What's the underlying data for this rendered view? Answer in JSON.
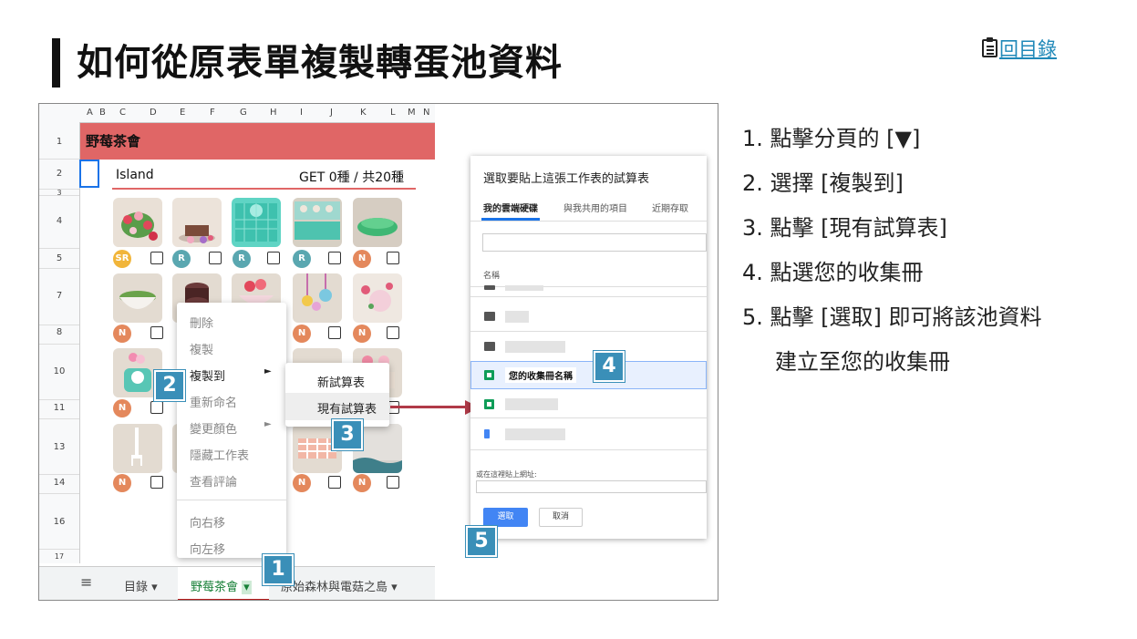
{
  "heading": "如何從原表單複製轉蛋池資料",
  "toc_link": "回目錄",
  "sheet": {
    "columns": [
      "A",
      "B",
      "C",
      "D",
      "E",
      "F",
      "G",
      "H",
      "I",
      "J",
      "K",
      "L",
      "M",
      "N"
    ],
    "rows": [
      "1",
      "2",
      "3",
      "4",
      "5",
      "7",
      "8",
      "10",
      "11",
      "13",
      "14",
      "16",
      "17"
    ],
    "banner": "野莓茶會",
    "subtitle": "Island",
    "get_count": "GET 0種 / 共20種",
    "badges": [
      "SR",
      "R",
      "R",
      "R",
      "N",
      "N",
      "N",
      "N",
      "N",
      "N",
      "N",
      "N",
      "N"
    ]
  },
  "context_menu": {
    "items": [
      "刪除",
      "複製",
      "複製到",
      "重新命名",
      "變更顏色",
      "隱藏工作表",
      "查看評論",
      "向右移",
      "向左移"
    ],
    "submenu_arrow": "►"
  },
  "submenu": {
    "items": [
      "新試算表",
      "現有試算表"
    ]
  },
  "tabs": {
    "menu_icon": "≡",
    "items": [
      "目錄",
      "野莓茶會",
      "原始森林與電菇之島"
    ],
    "caret": "▾"
  },
  "dialog": {
    "title": "選取要貼上這張工作表的試算表",
    "tabs": [
      "我的雲端硬碟",
      "與我共用的項目",
      "近期存取"
    ],
    "column_header": "名稱",
    "highlighted_file": "您的收集冊名稱",
    "url_label": "或在這裡貼上網址:",
    "select_button": "選取",
    "cancel_button": "取消"
  },
  "callouts": [
    "1",
    "2",
    "3",
    "4",
    "5"
  ],
  "steps": [
    "1. 點擊分頁的 [▼]",
    "2. 選擇 [複製到]",
    "3. 點擊 [現有試算表]",
    "4. 點選您的收集冊",
    "5. 點擊 [選取] 即可將該池資料",
    "建立至您的收集冊"
  ],
  "colors": {
    "banner": "#e06666",
    "callout": "#3a8fb8",
    "arrow": "#b03a48",
    "link": "#1f88b8",
    "badge_sr": "#f1b53a",
    "badge_r": "#5aa7b0",
    "badge_n": "#e4885c"
  }
}
